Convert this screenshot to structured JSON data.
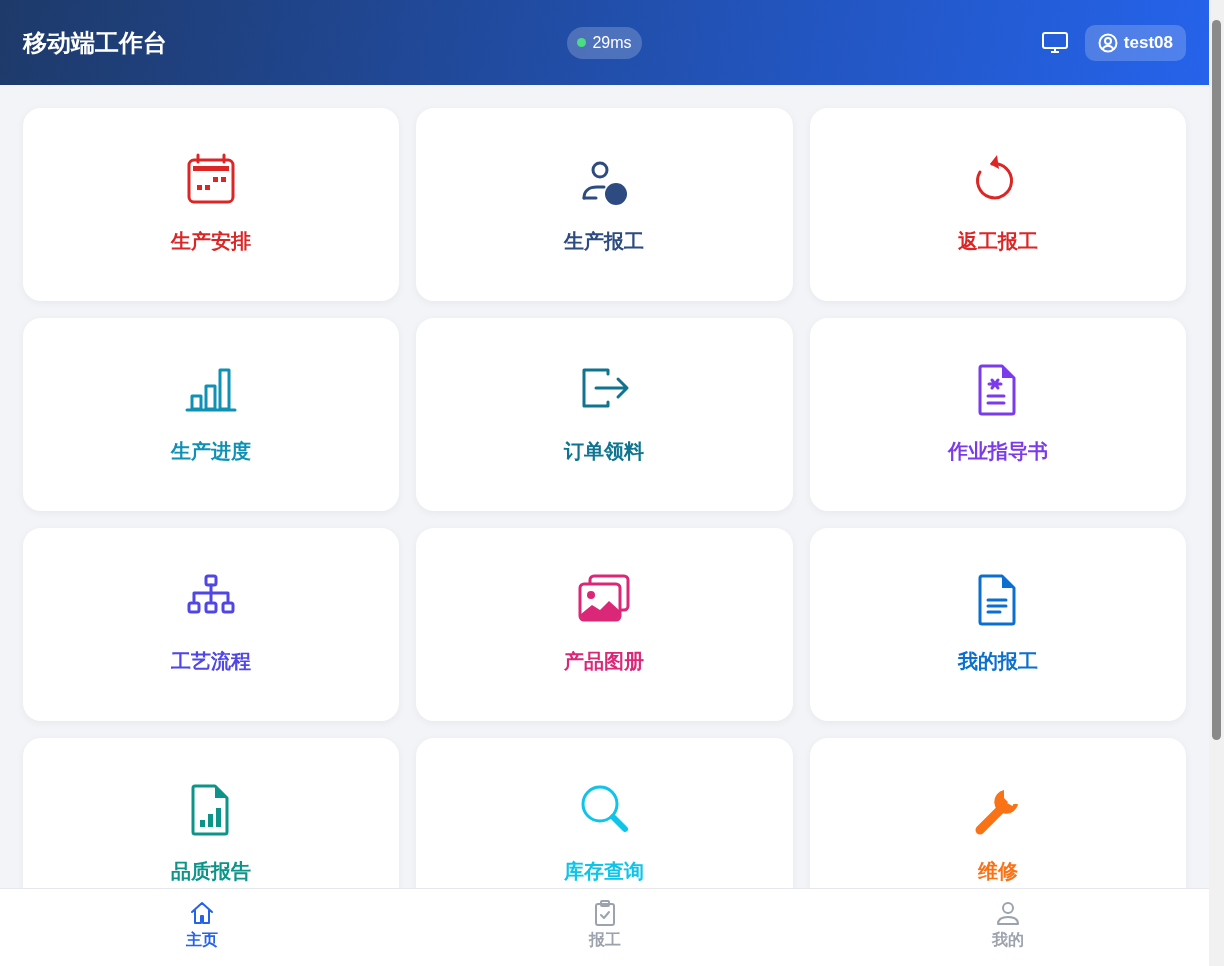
{
  "header": {
    "title": "移动端工作台",
    "latency": "29ms",
    "user": "test08"
  },
  "tiles": [
    {
      "label": "生产安排",
      "kind": "calendar",
      "color": "#dc2626"
    },
    {
      "label": "生产报工",
      "kind": "user",
      "color": "#2d4b80"
    },
    {
      "label": "返工报工",
      "kind": "redo",
      "color": "#dc2626"
    },
    {
      "label": "生产进度",
      "kind": "bars",
      "color": "#0e91b5"
    },
    {
      "label": "订单领料",
      "kind": "exit",
      "color": "#0e7490"
    },
    {
      "label": "作业指导书",
      "kind": "doc-star",
      "color": "#7c3aed"
    },
    {
      "label": "工艺流程",
      "kind": "tree",
      "color": "#4f46e5"
    },
    {
      "label": "产品图册",
      "kind": "images",
      "color": "#db2777"
    },
    {
      "label": "我的报工",
      "kind": "doc",
      "color": "#0b6fd0"
    },
    {
      "label": "品质报告",
      "kind": "doc-chart",
      "color": "#0d9488"
    },
    {
      "label": "库存查询",
      "kind": "search",
      "color": "#0ec4e8"
    },
    {
      "label": "维修",
      "kind": "wrench",
      "color": "#f97316"
    }
  ],
  "nav": [
    {
      "label": "主页",
      "kind": "home",
      "selected": true
    },
    {
      "label": "报工",
      "kind": "clipboard",
      "selected": false
    },
    {
      "label": "我的",
      "kind": "person",
      "selected": false
    }
  ]
}
